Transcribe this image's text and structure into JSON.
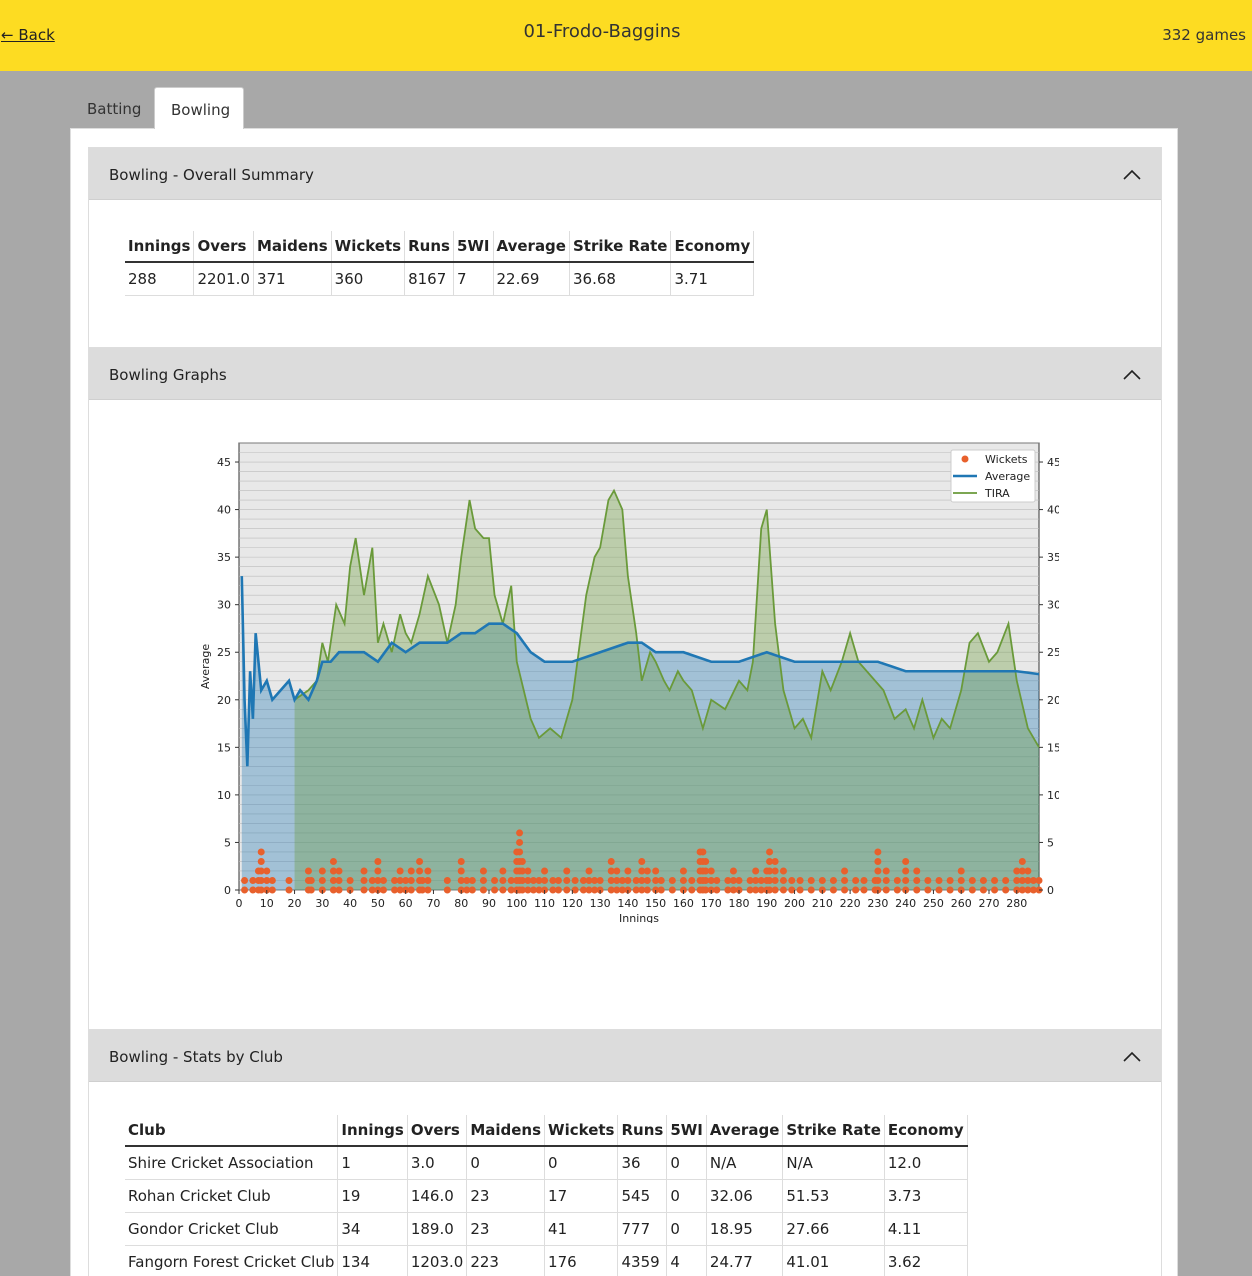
{
  "header": {
    "back_label": "← Back",
    "title": "01-Frodo-Baggins",
    "games": "332 games"
  },
  "tabs": [
    {
      "label": "Batting",
      "active": false
    },
    {
      "label": "Bowling",
      "active": true
    }
  ],
  "summary": {
    "title": "Bowling - Overall Summary",
    "headers": [
      "Innings",
      "Overs",
      "Maidens",
      "Wickets",
      "Runs",
      "5WI",
      "Average",
      "Strike Rate",
      "Economy"
    ],
    "row": [
      "288",
      "2201.0",
      "371",
      "360",
      "8167",
      "7",
      "22.69",
      "36.68",
      "3.71"
    ]
  },
  "graphs": {
    "title": "Bowling Graphs"
  },
  "clubs": {
    "title": "Bowling - Stats by Club",
    "headers": [
      "Club",
      "Innings",
      "Overs",
      "Maidens",
      "Wickets",
      "Runs",
      "5WI",
      "Average",
      "Strike Rate",
      "Economy"
    ],
    "rows": [
      [
        "Shire Cricket Association",
        "1",
        "3.0",
        "0",
        "0",
        "36",
        "0",
        "N/A",
        "N/A",
        "12.0"
      ],
      [
        "Rohan Cricket Club",
        "19",
        "146.0",
        "23",
        "17",
        "545",
        "0",
        "32.06",
        "51.53",
        "3.73"
      ],
      [
        "Gondor Cricket Club",
        "34",
        "189.0",
        "23",
        "41",
        "777",
        "0",
        "18.95",
        "27.66",
        "4.11"
      ],
      [
        "Fangorn Forest Cricket Club",
        "134",
        "1203.0",
        "223",
        "176",
        "4359",
        "4",
        "24.77",
        "41.01",
        "3.62"
      ]
    ]
  },
  "colors": {
    "accent": "#fddc22",
    "average": "#1f77b4",
    "tira": "#6a9a3a",
    "wickets": "#e8602c"
  },
  "chart_data": {
    "type": "line",
    "xlabel": "Innings",
    "ylabel": "Average",
    "xlim": [
      0,
      288
    ],
    "ylim": [
      0,
      47
    ],
    "x_ticks": [
      0,
      10,
      20,
      30,
      40,
      50,
      60,
      70,
      80,
      90,
      100,
      110,
      120,
      130,
      140,
      150,
      160,
      170,
      180,
      190,
      200,
      210,
      220,
      230,
      240,
      250,
      260,
      270,
      280
    ],
    "y_ticks": [
      0,
      5,
      10,
      15,
      20,
      25,
      30,
      35,
      40,
      45
    ],
    "legend": [
      "Wickets",
      "Average",
      "TIRA"
    ],
    "legend_position": "top-right",
    "grid": true,
    "series": [
      {
        "name": "Average",
        "x": [
          1,
          2,
          3,
          4,
          5,
          6,
          8,
          10,
          12,
          15,
          18,
          20,
          22,
          25,
          28,
          30,
          33,
          36,
          40,
          45,
          50,
          55,
          60,
          65,
          70,
          75,
          80,
          85,
          90,
          95,
          100,
          105,
          110,
          120,
          130,
          140,
          145,
          150,
          160,
          170,
          175,
          180,
          190,
          200,
          210,
          220,
          230,
          240,
          250,
          260,
          270,
          280,
          288
        ],
        "y": [
          33,
          20,
          13,
          23,
          18,
          27,
          21,
          22,
          20,
          21,
          22,
          20,
          21,
          20,
          22,
          24,
          24,
          25,
          25,
          25,
          24,
          26,
          25,
          26,
          26,
          26,
          27,
          27,
          28,
          28,
          27,
          25,
          24,
          24,
          25,
          26,
          26,
          25,
          25,
          24,
          24,
          24,
          25,
          24,
          24,
          24,
          24,
          23,
          23,
          23,
          23,
          23,
          22.7
        ]
      },
      {
        "name": "TIRA",
        "x": [
          20,
          25,
          28,
          30,
          32,
          35,
          38,
          40,
          42,
          45,
          48,
          50,
          52,
          55,
          58,
          60,
          62,
          65,
          68,
          72,
          75,
          78,
          80,
          83,
          85,
          88,
          90,
          92,
          95,
          98,
          100,
          105,
          108,
          112,
          116,
          120,
          125,
          128,
          130,
          133,
          135,
          138,
          140,
          143,
          145,
          148,
          150,
          153,
          155,
          158,
          160,
          163,
          167,
          170,
          175,
          180,
          183,
          185,
          188,
          190,
          193,
          196,
          200,
          203,
          206,
          210,
          213,
          217,
          220,
          223,
          226,
          229,
          232,
          236,
          240,
          243,
          246,
          250,
          253,
          256,
          260,
          263,
          266,
          270,
          273,
          277,
          280,
          284,
          288
        ],
        "y": [
          20,
          21,
          22,
          26,
          24,
          30,
          28,
          34,
          37,
          31,
          36,
          26,
          28,
          25,
          29,
          27,
          26,
          29,
          33,
          30,
          26,
          30,
          35,
          41,
          38,
          37,
          37,
          31,
          28,
          32,
          24,
          18,
          16,
          17,
          16,
          20,
          31,
          35,
          36,
          41,
          42,
          40,
          33,
          27,
          22,
          25,
          24,
          22,
          21,
          23,
          22,
          21,
          17,
          20,
          19,
          22,
          21,
          24,
          38,
          40,
          28,
          21,
          17,
          18,
          16,
          23,
          21,
          24,
          27,
          24,
          23,
          22,
          21,
          18,
          19,
          17,
          20,
          16,
          18,
          17,
          21,
          26,
          27,
          24,
          25,
          28,
          22,
          17,
          15
        ]
      },
      {
        "name": "Wickets",
        "x": [
          2,
          5,
          7,
          8,
          10,
          12,
          18,
          25,
          26,
          30,
          34,
          36,
          40,
          45,
          48,
          50,
          52,
          56,
          58,
          60,
          62,
          65,
          66,
          68,
          75,
          80,
          82,
          84,
          88,
          92,
          95,
          98,
          100,
          101,
          102,
          104,
          106,
          108,
          110,
          113,
          115,
          118,
          121,
          124,
          126,
          128,
          130,
          134,
          136,
          138,
          140,
          143,
          145,
          147,
          150,
          152,
          156,
          160,
          163,
          166,
          167,
          168,
          170,
          172,
          176,
          178,
          180,
          184,
          186,
          188,
          190,
          191,
          193,
          196,
          199,
          202,
          206,
          210,
          214,
          218,
          222,
          225,
          229,
          230,
          233,
          237,
          240,
          244,
          248,
          252,
          256,
          260,
          264,
          268,
          272,
          276,
          280,
          282,
          284,
          286,
          288
        ],
        "y": [
          1,
          1,
          2,
          4,
          2,
          1,
          1,
          2,
          1,
          2,
          3,
          2,
          1,
          2,
          1,
          3,
          1,
          1,
          2,
          1,
          2,
          3,
          1,
          2,
          1,
          3,
          1,
          1,
          2,
          1,
          2,
          1,
          4,
          6,
          3,
          2,
          1,
          1,
          2,
          1,
          1,
          2,
          1,
          1,
          2,
          1,
          1,
          3,
          2,
          1,
          2,
          1,
          3,
          2,
          2,
          1,
          1,
          2,
          1,
          4,
          4,
          3,
          2,
          1,
          1,
          2,
          1,
          1,
          2,
          1,
          2,
          4,
          3,
          2,
          1,
          1,
          1,
          1,
          1,
          2,
          1,
          1,
          1,
          4,
          2,
          1,
          3,
          2,
          1,
          1,
          1,
          2,
          1,
          1,
          1,
          1,
          2,
          3,
          2,
          1,
          1
        ]
      }
    ]
  }
}
